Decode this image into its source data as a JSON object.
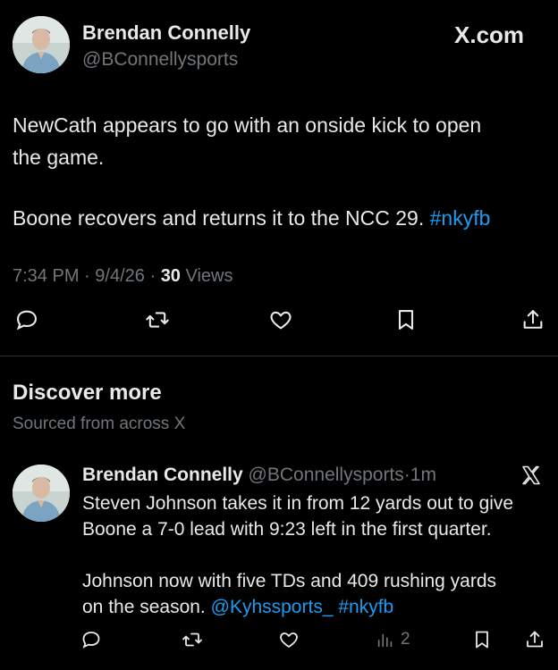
{
  "post": {
    "author_name": "Brendan Connelly",
    "author_handle": "@BConnellysports",
    "site_label": "X.com",
    "text_line1": "NewCath appears to go with an onside kick to open",
    "text_line2": "the game.",
    "text_line3": "Boone recovers and returns it to the NCC 29.",
    "hashtag": "#nkyfb",
    "time": "7:34 PM",
    "date": "9/4/26",
    "views_count": "30",
    "views_label": "Views",
    "actions": [
      "reply-icon",
      "repost-icon",
      "like-icon",
      "bookmark-icon",
      "share-icon"
    ]
  },
  "discover": {
    "title": "Discover more",
    "subtitle": "Sourced from across X"
  },
  "reply": {
    "author_name": "Brendan Connelly",
    "author_handle": "@BConnellysports",
    "separator": "·",
    "age": "1m",
    "text_line1": "Steven Johnson takes it in from 12 yards out to give",
    "text_line2": "Boone a 7-0 lead with 9:23 left in the first quarter.",
    "text_line3": "Johnson now with five TDs and 409 rushing yards",
    "text_line4_plain": "on the season.",
    "mention": "@Kyhssports_",
    "hashtag": "#nkyfb",
    "views_count": "2"
  },
  "colors": {
    "background": "#000000",
    "text": "#e7e9ea",
    "muted": "#71767b",
    "link": "#1d9bf0"
  }
}
